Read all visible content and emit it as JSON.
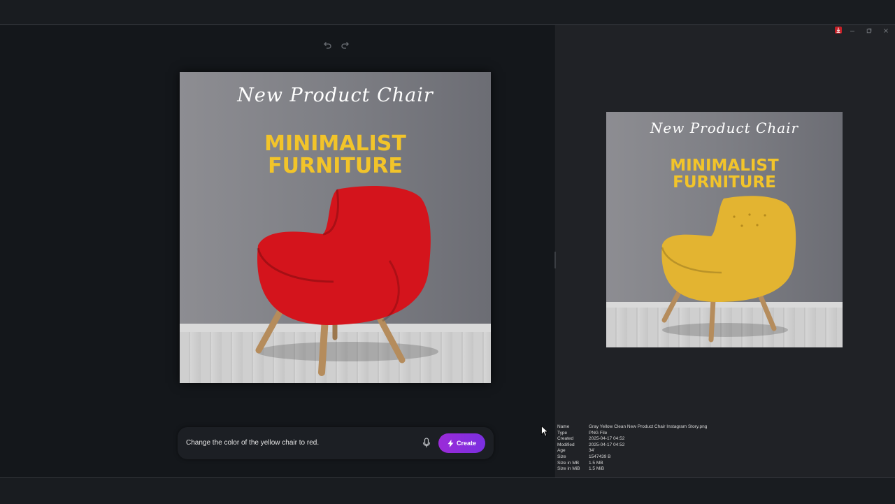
{
  "editor": {
    "poster": {
      "script_title": "New Product Chair",
      "headline": [
        "MINIMALIST",
        "FURNITURE"
      ],
      "chair_color": "#d4141c"
    },
    "prompt": {
      "text": "Change the color of the yellow chair to red.",
      "create_label": "Create"
    }
  },
  "preview": {
    "poster": {
      "script_title": "New Product Chair",
      "headline": [
        "MINIMALIST",
        "FURNITURE"
      ],
      "chair_color": "#e3b431"
    },
    "file_details": [
      {
        "key": "Name",
        "value": "Gray Yellow Clean New Product Chair Instagram Story.png"
      },
      {
        "key": "Type",
        "value": "PNG File"
      },
      {
        "key": "Created",
        "value": "2025-04-17  04:52"
      },
      {
        "key": "Modified",
        "value": "2025-04-17  04:52"
      },
      {
        "key": "Age",
        "value": "34'"
      },
      {
        "key": "Size",
        "value": "1547439 B"
      },
      {
        "key": "Size in MB",
        "value": "1.5 MB"
      },
      {
        "key": "Size in MiB",
        "value": "1.5 MiB"
      }
    ]
  },
  "colors": {
    "accent": "#8a2be2",
    "headline": "#f2c42a"
  },
  "icons": [
    "undo-icon",
    "redo-icon",
    "mic-icon",
    "bolt-icon",
    "download-icon",
    "minimize-icon",
    "restore-icon",
    "close-icon",
    "cursor-icon"
  ]
}
